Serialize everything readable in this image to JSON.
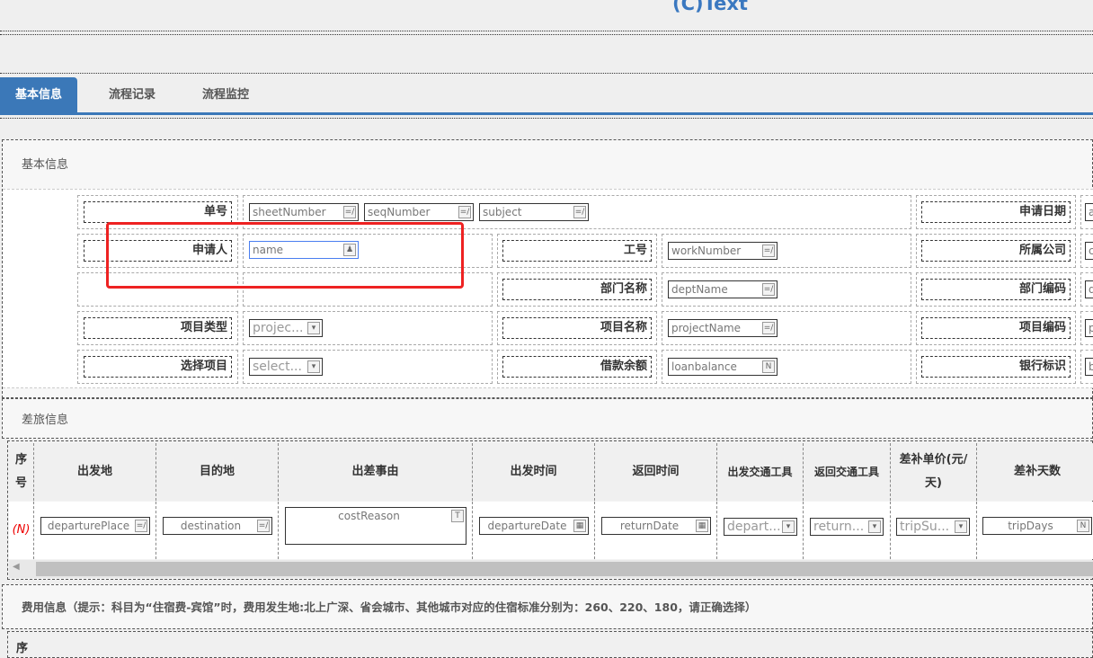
{
  "header": {
    "title": "(C)Text"
  },
  "tabs": [
    {
      "label": "基本信息",
      "active": true
    },
    {
      "label": "流程记录"
    },
    {
      "label": "流程监控"
    }
  ],
  "basic": {
    "title": "基本信息",
    "sheet_label": "单号",
    "sheetNumber": "sheetNumber",
    "seqNumber": "seqNumber",
    "subject": "subject",
    "apply_date_label": "申请日期",
    "apply_date_value": "a",
    "applicant_label": "申请人",
    "applicant_value": "name",
    "work_number_label": "工号",
    "work_number_value": "workNumber",
    "company_label": "所属公司",
    "company_value": "c",
    "dept_name_label": "部门名称",
    "dept_name_value": "deptName",
    "dept_code_label": "部门编码",
    "dept_code_value": "d",
    "project_type_label": "项目类型",
    "project_type_value": "projec...",
    "project_name_label": "项目名称",
    "project_name_value": "projectName",
    "project_code_label": "项目编码",
    "project_code_value": "p",
    "select_project_label": "选择项目",
    "select_project_value": "select...",
    "loan_label": "借款余额",
    "loan_value": "loanbalance",
    "bank_label": "银行标识",
    "bank_value": "b"
  },
  "travel": {
    "title": "差旅信息",
    "columns": [
      "序号",
      "出发地",
      "目的地",
      "出差事由",
      "出发时间",
      "返回时间",
      "出发交通工具",
      "返回交通工具",
      "差补单价(元/天)",
      "差补天数"
    ],
    "row": {
      "index": "(N)",
      "cells": [
        "departurePlace",
        "destination",
        "costReason",
        "departureDate",
        "returnDate",
        "depart...",
        "return...",
        "tripSu...",
        "tripDays"
      ]
    }
  },
  "expense": {
    "title": "费用信息（提示：科目为“住宿费-宾馆”时，费用发生地:北上广深、省会城市、其他城市对应的住宿标准分别为：260、220、180，请正确选择）",
    "first_col": "序"
  }
}
